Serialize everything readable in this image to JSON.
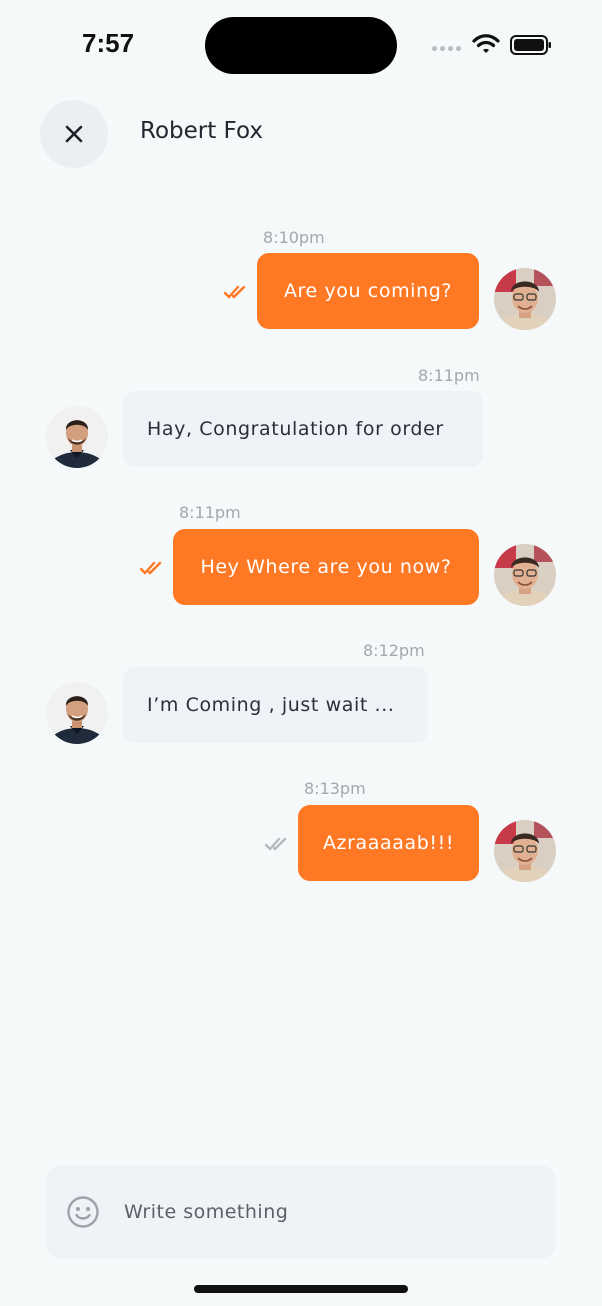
{
  "status_bar": {
    "time": "7:57"
  },
  "header": {
    "close_icon": "close-icon",
    "contact_name": "Robert Fox"
  },
  "messages": [
    {
      "direction": "outgoing",
      "time": "8:10pm",
      "text": "Are you coming?",
      "read": true
    },
    {
      "direction": "incoming",
      "time": "8:11pm",
      "text": "Hay, Congratulation for order"
    },
    {
      "direction": "outgoing",
      "time": "8:11pm",
      "text": "Hey Where are you now?",
      "read": true
    },
    {
      "direction": "incoming",
      "time": "8:12pm",
      "text": "I’m Coming , just wait ..."
    },
    {
      "direction": "outgoing",
      "time": "8:13pm",
      "text": "Azraaaaab!!!",
      "read": false
    }
  ],
  "composer": {
    "emoji_icon": "smiley-icon",
    "placeholder": "Write something"
  },
  "colors": {
    "accent": "#ff7824",
    "incoming_bubble": "#eff2f6",
    "background": "#f6f9f9",
    "tick_read": "#ff7824",
    "tick_unread": "#b5b9be"
  }
}
